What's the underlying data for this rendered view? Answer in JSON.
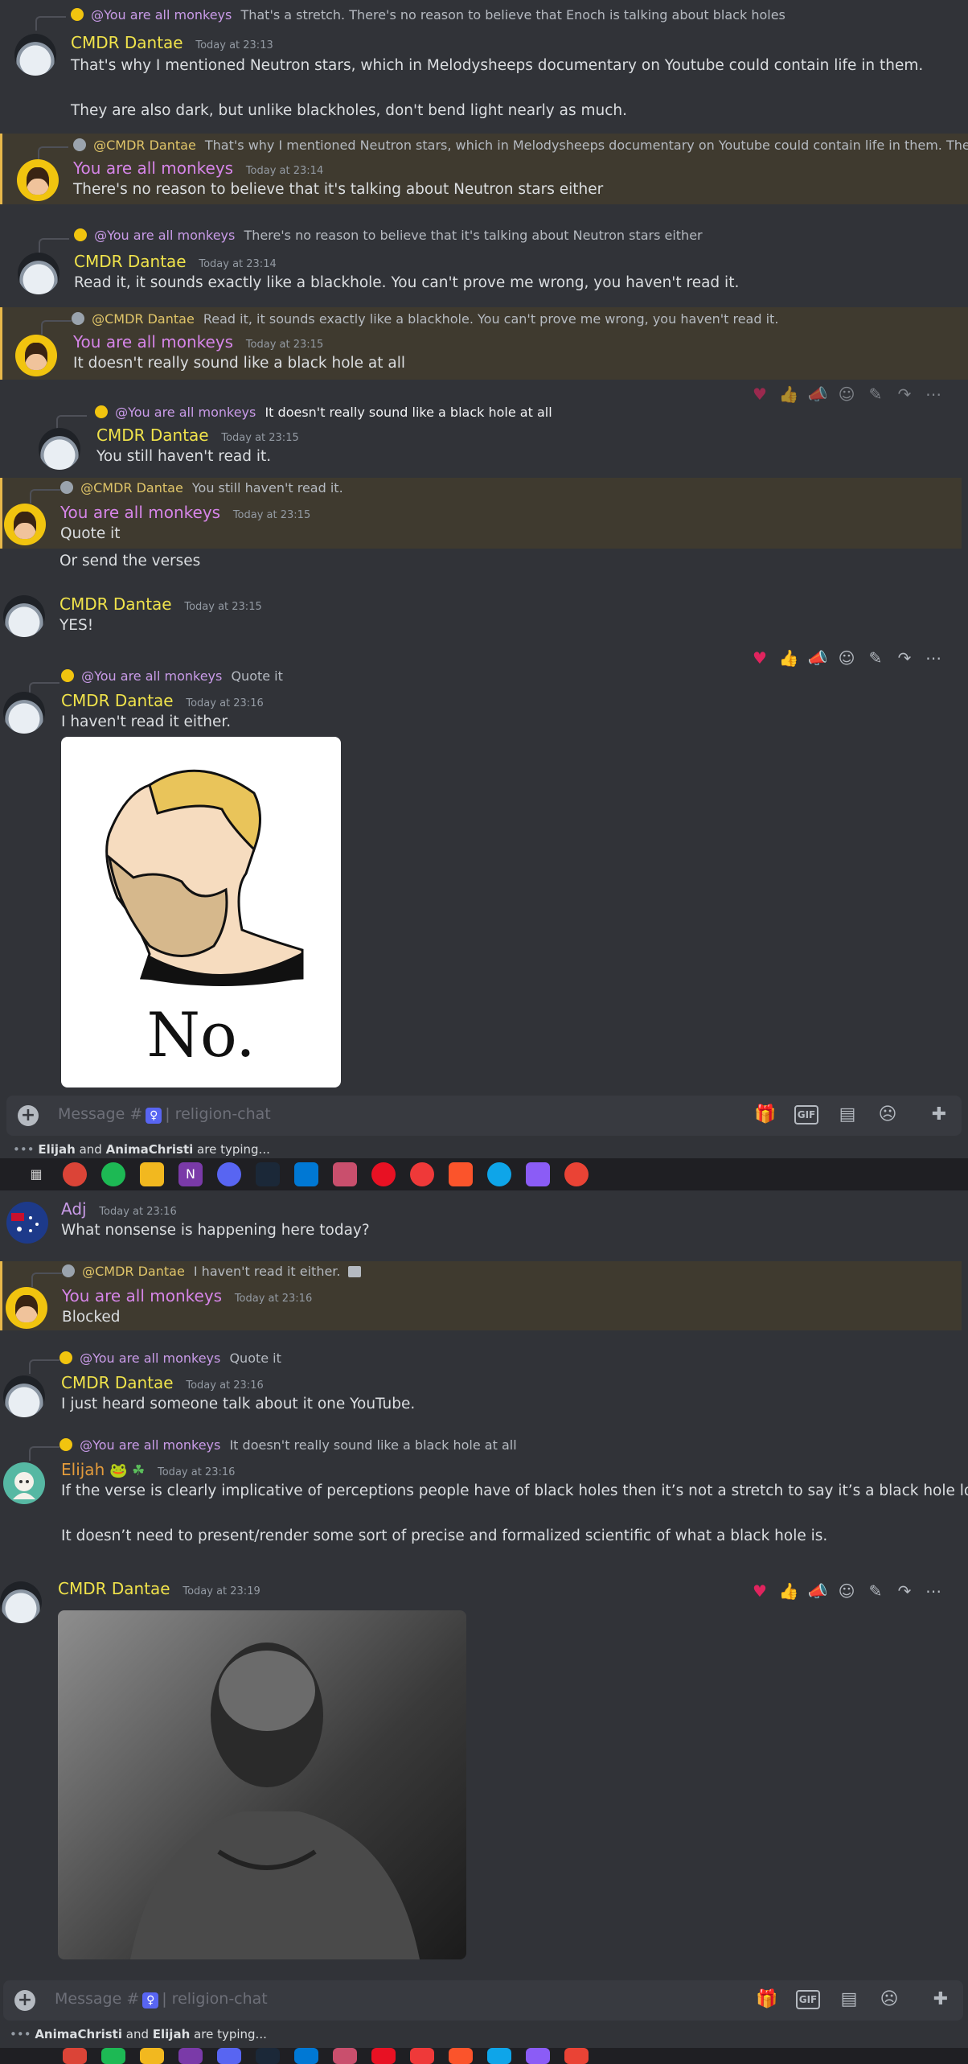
{
  "channel": "religion-chat",
  "composer_placeholder_prefix": "Message #",
  "composer_channel_icon": "♀",
  "composer_channel_sep": "| religion-chat",
  "panel1": {
    "messages": [
      {
        "reply": {
          "who": "@You are all monkeys",
          "text": "That's a stretch. There's no reason to believe that Enoch is talking about black holes"
        },
        "author": "CMDR Dantae",
        "time": "Today at 23:13",
        "lines": [
          "That's why I mentioned Neutron stars, which in Melodysheeps documentary on Youtube could contain life in them.",
          "",
          "They are also dark, but unlike blackholes, don't bend light nearly as much."
        ]
      },
      {
        "reply": {
          "who": "@CMDR Dantae",
          "text": "That's why I mentioned Neutron stars, which in Melodysheeps documentary on Youtube could contain life in them.  They ..."
        },
        "author": "You are all monkeys",
        "time": "Today at 23:14",
        "lines": [
          "There's no reason to believe that it's talking about Neutron stars either"
        ]
      },
      {
        "reply": {
          "who": "@You are all monkeys",
          "text": "There's no reason to believe that it's talking about Neutron stars either"
        },
        "author": "CMDR Dantae",
        "time": "Today at 23:14",
        "lines": [
          "Read it, it sounds exactly like a blackhole. You can't prove me wrong, you haven't read it."
        ]
      },
      {
        "reply": {
          "who": "@CMDR Dantae",
          "text": "Read it, it sounds exactly like a blackhole. You can't prove me wrong, you haven't read it."
        },
        "author": "You are all monkeys",
        "time": "Today at 23:15",
        "lines": [
          "It doesn't really sound like a black hole at all"
        ]
      },
      {
        "reply": {
          "who": "@You are all monkeys",
          "text": "It doesn't really sound like a black hole at all"
        },
        "author": "CMDR Dantae",
        "time": "Today at 23:15",
        "lines": [
          "You still haven't read it."
        ]
      },
      {
        "reply": {
          "who": "@CMDR Dantae",
          "text": "You still haven't read it."
        },
        "author": "You are all monkeys",
        "time": "Today at 23:15",
        "lines": [
          "Quote it",
          "Or send the verses"
        ]
      },
      {
        "author": "CMDR Dantae",
        "time": "Today at 23:15",
        "lines": [
          "YES!"
        ]
      },
      {
        "reply": {
          "who": "@You are all monkeys",
          "text": "Quote it"
        },
        "author": "CMDR Dantae",
        "time": "Today at 23:16",
        "lines": [
          "I haven't read it either."
        ],
        "image_caption": "No."
      }
    ],
    "typing": {
      "a": "Elijah",
      "and": "and",
      "b": "AnimaChristi",
      "suffix": "are typing..."
    }
  },
  "panel2": {
    "messages": [
      {
        "author": "Adj",
        "time": "Today at 23:16",
        "lines": [
          "What nonsense is happening here today?"
        ]
      },
      {
        "reply": {
          "who": "@CMDR Dantae",
          "text": "I haven't read it either."
        },
        "author": "You are all monkeys",
        "time": "Today at 23:16",
        "lines": [
          "Blocked"
        ]
      },
      {
        "reply": {
          "who": "@You are all monkeys",
          "text": "Quote it"
        },
        "author": "CMDR Dantae",
        "time": "Today at 23:16",
        "lines": [
          "I just heard someone talk about it one YouTube."
        ]
      },
      {
        "reply": {
          "who": "@You are all monkeys",
          "text": "It doesn't really sound like a black hole at all"
        },
        "author": "Elijah",
        "author_badges": "🐸 ☘",
        "time": "Today at 23:16",
        "lines": [
          "If the verse is clearly implicative of perceptions people have of black holes then it’s not a stretch to say it’s a black hole lol.",
          "",
          "It doesn’t need to present/render some sort of precise and formalized scientific of what a black hole is."
        ]
      },
      {
        "author": "CMDR Dantae",
        "time": "Today at 23:19",
        "lines": []
      }
    ],
    "typing": {
      "a": "AnimaChristi",
      "and": "and",
      "b": "Elijah",
      "suffix": "are typing..."
    }
  },
  "toolbar_icons": [
    "heart-reaction-icon",
    "thumbs-up-reaction-icon",
    "megaphone-reaction-icon",
    "add-reaction-icon",
    "edit-icon",
    "forward-icon",
    "more-icon"
  ],
  "composer_icons": [
    "gift-icon",
    "gif-icon",
    "sticker-icon",
    "emoji-icon",
    "apps-icon"
  ],
  "colors": {
    "bg": "#313338",
    "mention_bg": "#3f3a2f",
    "cmdr_name": "#f0e34b",
    "monkeys_name": "#d685e8"
  }
}
